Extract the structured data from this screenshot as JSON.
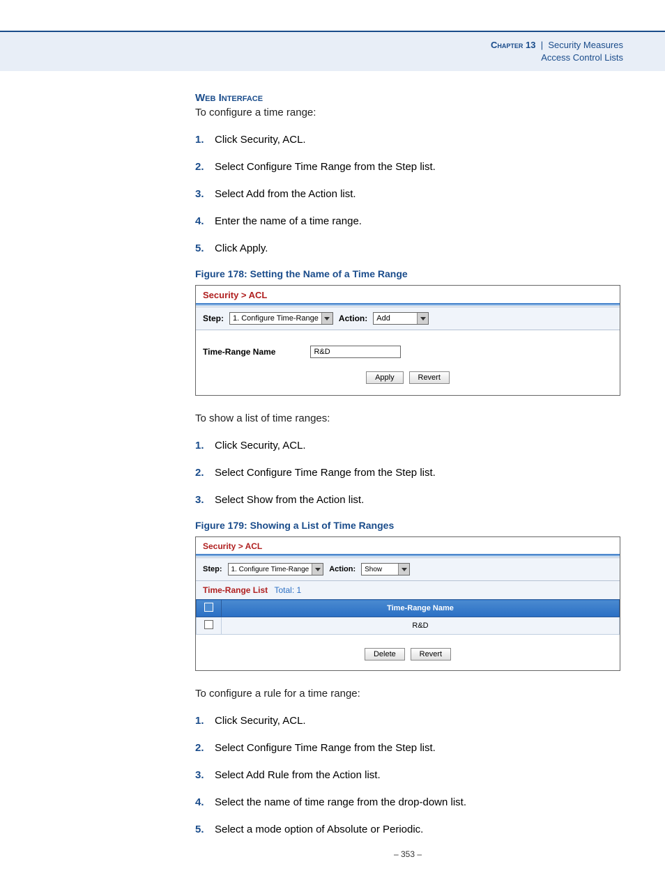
{
  "header": {
    "chapter_label": "Chapter 13",
    "separator": "|",
    "title": "Security Measures",
    "subtitle": "Access Control Lists"
  },
  "section_heading": "Web Interface",
  "intro_1": "To configure a time range:",
  "steps_1": [
    "Click Security, ACL.",
    "Select Configure Time Range from the Step list.",
    "Select Add from the Action list.",
    "Enter the name of a time range.",
    "Click Apply."
  ],
  "figure_178": {
    "caption": "Figure 178:  Setting the Name of a Time Range",
    "breadcrumb": "Security > ACL",
    "step_label": "Step:",
    "step_value": "1. Configure Time-Range",
    "action_label": "Action:",
    "action_value": "Add",
    "field_label": "Time-Range Name",
    "field_value": "R&D",
    "apply": "Apply",
    "revert": "Revert"
  },
  "intro_2": "To show a list of time ranges:",
  "steps_2": [
    "Click Security, ACL.",
    "Select Configure Time Range from the Step list.",
    "Select Show from the Action list."
  ],
  "figure_179": {
    "caption": "Figure 179:  Showing a List of Time Ranges",
    "breadcrumb": "Security > ACL",
    "step_label": "Step:",
    "step_value": "1. Configure Time-Range",
    "action_label": "Action:",
    "action_value": "Show",
    "list_label": "Time-Range List",
    "total_label": "Total: 1",
    "col_name": "Time-Range Name",
    "row_value": "R&D",
    "delete": "Delete",
    "revert": "Revert"
  },
  "intro_3": "To configure a rule for a time range:",
  "steps_3": [
    "Click Security, ACL.",
    "Select Configure Time Range from the Step list.",
    "Select Add Rule from the Action list.",
    "Select the name of time range from the drop-down list.",
    "Select a mode option of Absolute or Periodic."
  ],
  "page_number": "–  353  –"
}
